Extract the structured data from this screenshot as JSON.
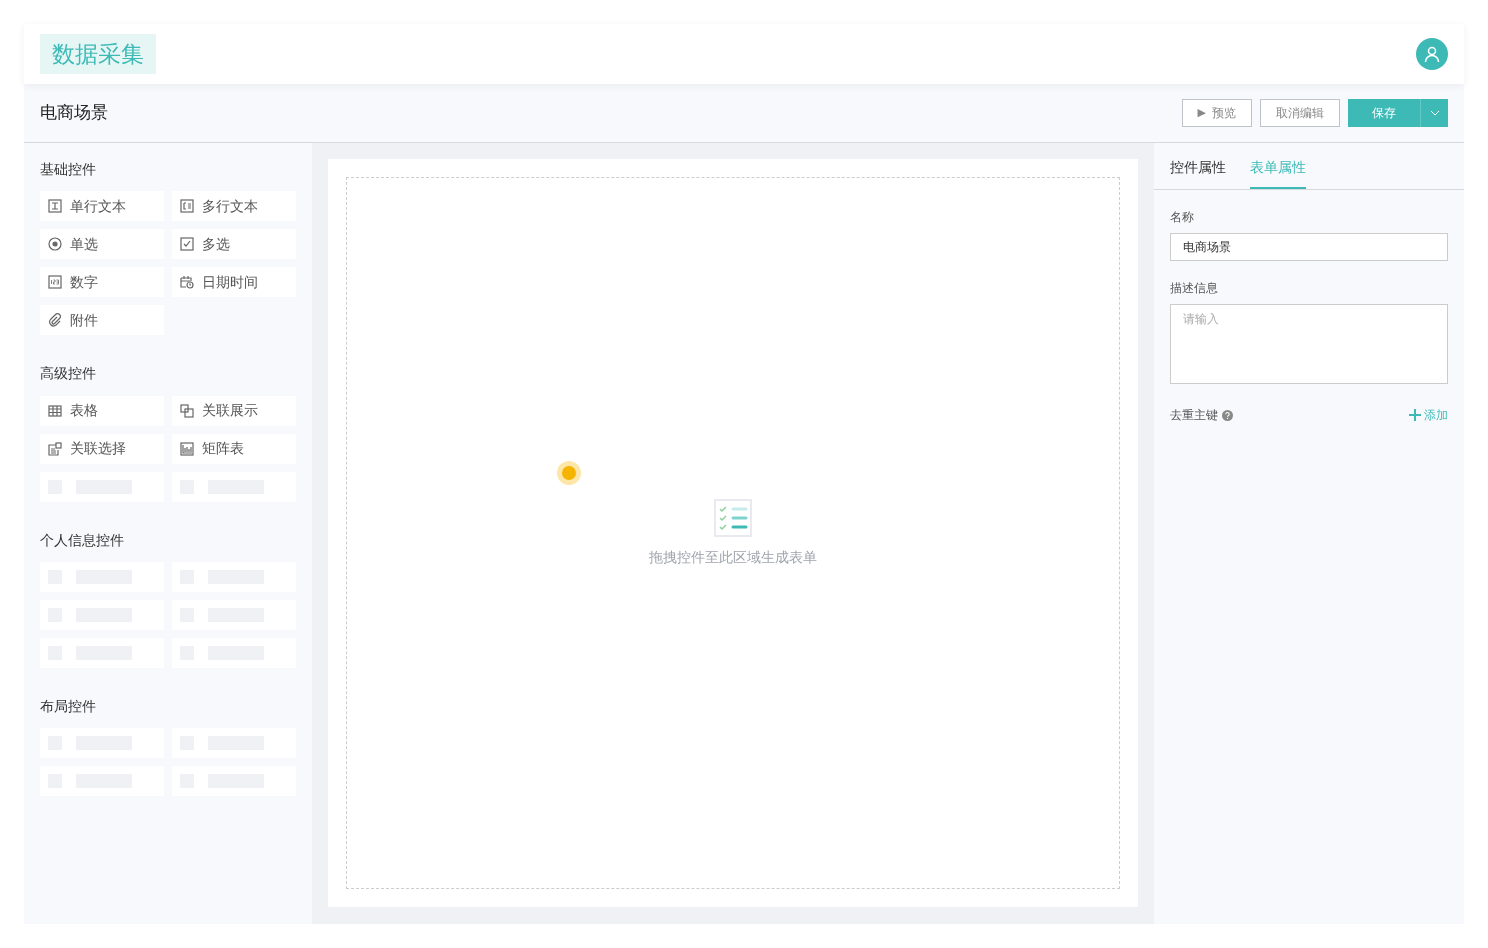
{
  "app": {
    "logo": "数据采集"
  },
  "page": {
    "title": "电商场景",
    "buttons": [
      {
        "kind": "preview",
        "label": "预览",
        "icon_char": "▶"
      },
      {
        "kind": "cancel",
        "label": "取消编辑"
      },
      {
        "kind": "primary",
        "label": "保存"
      }
    ]
  },
  "sidebar": {
    "groups": [
      {
        "title": "基础控件",
        "items": [
          {
            "kind": "control",
            "label": "单行文本"
          },
          {
            "kind": "control",
            "label": "多行文本"
          },
          {
            "kind": "control",
            "label": "单选"
          },
          {
            "kind": "control",
            "label": "多选"
          },
          {
            "kind": "control",
            "label": "数字"
          },
          {
            "kind": "control",
            "label": "日期时间"
          },
          {
            "kind": "control",
            "label": "附件"
          }
        ]
      },
      {
        "title": "高级控件",
        "items": [
          {
            "kind": "control",
            "label": "表格"
          },
          {
            "kind": "control",
            "label": "关联展示"
          },
          {
            "kind": "control",
            "label": "关联选择"
          },
          {
            "kind": "control",
            "label": "矩阵表"
          },
          {
            "kind": "skeleton"
          },
          {
            "kind": "skeleton"
          }
        ]
      },
      {
        "title": "个人信息控件",
        "items": [
          {
            "kind": "skeleton"
          },
          {
            "kind": "skeleton"
          },
          {
            "kind": "skeleton"
          },
          {
            "kind": "skeleton"
          },
          {
            "kind": "skeleton"
          },
          {
            "kind": "skeleton"
          }
        ]
      },
      {
        "title": "布局控件",
        "items": [
          {
            "kind": "skeleton"
          },
          {
            "kind": "skeleton"
          },
          {
            "kind": "skeleton"
          },
          {
            "kind": "skeleton"
          }
        ]
      }
    ]
  },
  "canvas": {
    "empty_text": "拖拽控件至此区域生成表单"
  },
  "properties": {
    "tabs": [
      {
        "label": "控件属性",
        "selected": false
      },
      {
        "label": "表单属性",
        "selected": true
      }
    ],
    "fields": [
      {
        "kind": "input",
        "label": "名称",
        "value": "电商场景"
      },
      {
        "kind": "textarea",
        "label": "描述信息",
        "placeholder": "请输入"
      }
    ],
    "dedupe": {
      "label": "去重主键",
      "action": "添加"
    }
  }
}
